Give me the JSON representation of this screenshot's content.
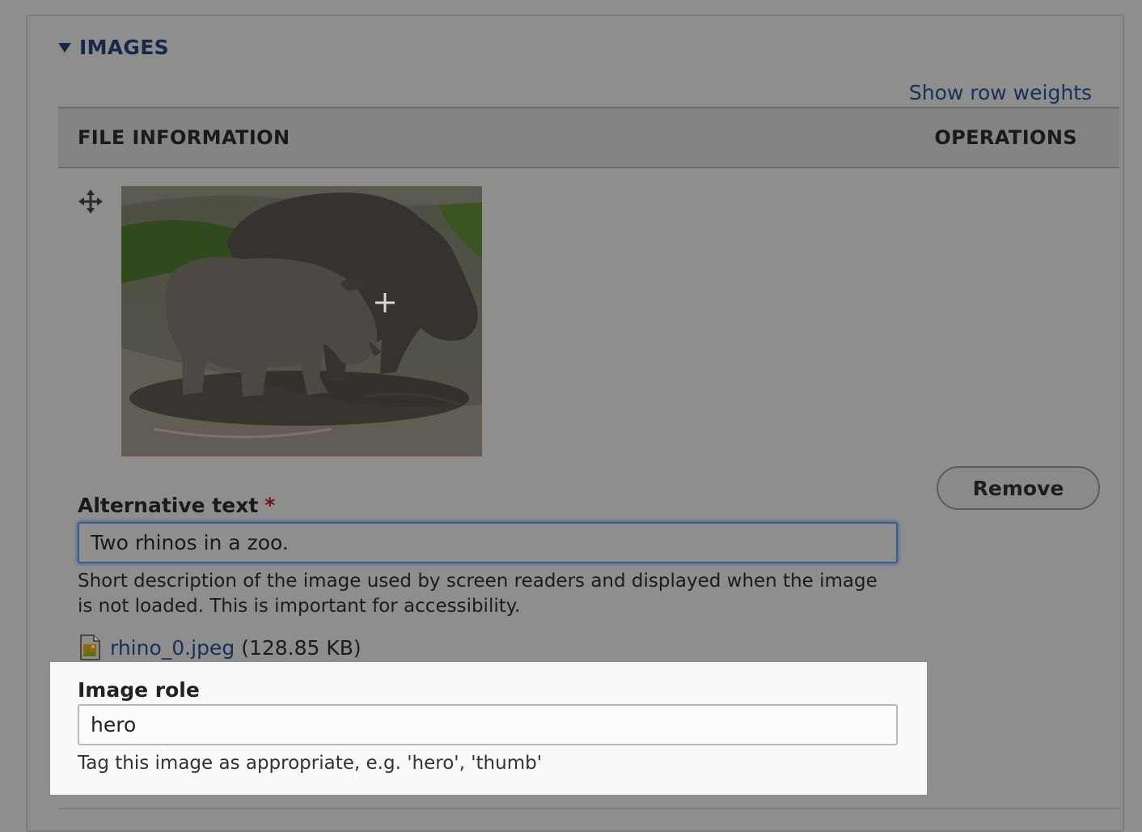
{
  "fieldset": {
    "legend": "IMAGES",
    "show_row_weights": "Show row weights"
  },
  "table": {
    "headers": {
      "file_information": "FILE INFORMATION",
      "operations": "OPERATIONS"
    }
  },
  "row": {
    "drag_icon": "move-cross-icon",
    "image": "rhinos-thumbnail",
    "remove_label": "Remove",
    "alt": {
      "label": "Alternative text",
      "required_marker": "*",
      "value": "Two rhinos in a zoo.",
      "description": "Short description of the image used by screen readers and displayed when the image is not loaded. This is important for accessibility."
    },
    "file": {
      "icon": "image-file-icon",
      "name": "rhino_0.jpeg",
      "size": "(128.85 KB)"
    },
    "role": {
      "label": "Image role",
      "value": "hero",
      "description": "Tag this image as appropriate, e.g. 'hero', 'thumb'"
    }
  },
  "colors": {
    "overlay": "#8e8e8c",
    "link": "#14325c",
    "highlight_bg": "#f9f9f7",
    "focus_border": "#3a5f8a",
    "required": "#7a1010"
  }
}
